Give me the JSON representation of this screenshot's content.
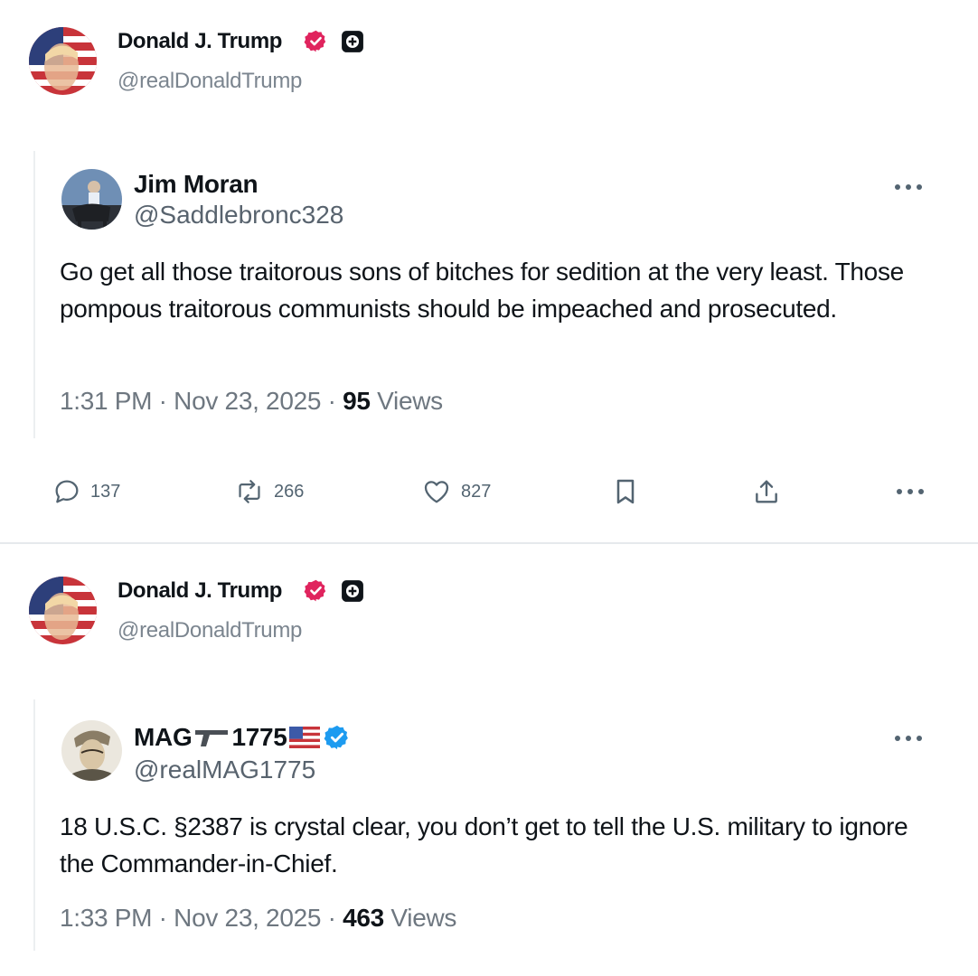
{
  "posts": [
    {
      "author": {
        "name": "Donald J. Trump",
        "handle": "@realDonaldTrump",
        "verified_color": "#e0245e"
      },
      "quoted": {
        "name": "Jim Moran",
        "handle": "@Saddlebronc328",
        "text": "Go get all those traitorous sons of bitches for sedition at the very least.  Those pompous traitorous communists should be impeached and prosecuted.",
        "time": "1:31 PM",
        "sep1": " · ",
        "date": "Nov 23, 2025",
        "sep2": " · ",
        "views_count": "95",
        "views_label": " Views"
      },
      "actions": {
        "replies": "137",
        "reposts": "266",
        "likes": "827"
      }
    },
    {
      "author": {
        "name": "Donald J. Trump",
        "handle": "@realDonaldTrump",
        "verified_color": "#e0245e"
      },
      "quoted": {
        "name": "MAG",
        "name_suffix": "1775",
        "handle": "@realMAG1775",
        "verified_color": "#1d9bf0",
        "text": "18 U.S.C. §2387 is crystal clear, you don’t get to tell the U.S. military to ignore the Commander-in-Chief.",
        "time": "1:33 PM",
        "sep1": " · ",
        "date": "Nov 23, 2025",
        "sep2": " · ",
        "views_count": "463",
        "views_label": " Views"
      }
    }
  ]
}
